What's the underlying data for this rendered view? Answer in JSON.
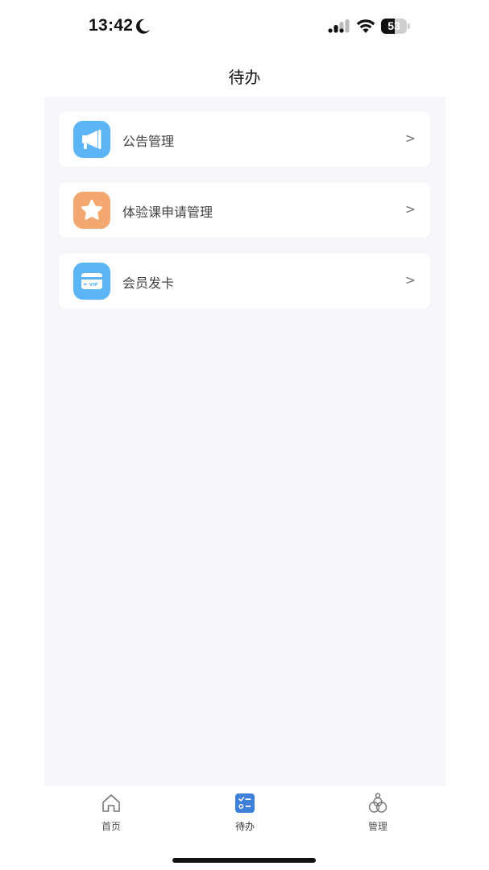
{
  "status_bar": {
    "time": "13:42",
    "battery_level": "53",
    "battery_fraction": 0.53
  },
  "header": {
    "title": "待办"
  },
  "menu": {
    "items": [
      {
        "label": "公告管理",
        "icon": "megaphone-icon",
        "color": "#5ab4f5",
        "chevron": ">"
      },
      {
        "label": "体验课申请管理",
        "icon": "star-icon",
        "color": "#f3a870",
        "chevron": ">"
      },
      {
        "label": "会员发卡",
        "icon": "vip-card-icon",
        "color": "#5ab4f5",
        "chevron": ">"
      }
    ]
  },
  "tabbar": {
    "tabs": [
      {
        "label": "首页",
        "icon": "home-icon",
        "active": false
      },
      {
        "label": "待办",
        "icon": "checklist-icon",
        "active": true
      },
      {
        "label": "管理",
        "icon": "nodes-icon",
        "active": false
      }
    ]
  },
  "colors": {
    "background": "#f5f6fa",
    "accent_blue": "#5ab4f5",
    "accent_orange": "#f3a870",
    "active_tab": "#3d7fd9"
  }
}
